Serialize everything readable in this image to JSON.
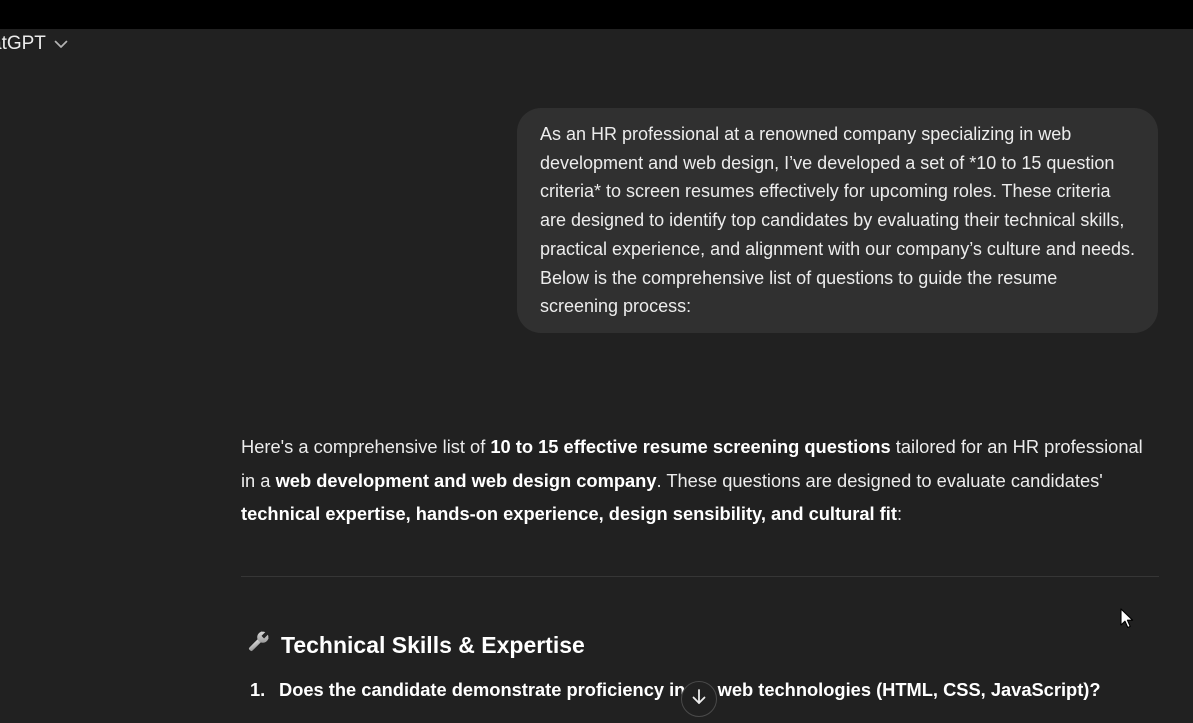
{
  "header": {
    "model_name": "atGPT",
    "chevron_icon": "chevron-down-icon"
  },
  "conversation": {
    "user_message": "As an HR professional at a renowned company specializing in web development and web design, I’ve developed a set of *10 to 15 question criteria* to screen resumes effectively for upcoming roles. These criteria are designed to identify top candidates by evaluating their technical skills, practical experience, and alignment with our company’s culture and needs. Below is the comprehensive list of questions to guide the resume screening process:",
    "assistant": {
      "intro_parts": [
        "Here's a comprehensive list of ",
        "10 to 15 effective resume screening questions",
        " tailored for an HR professional in a ",
        "web development and web design company",
        ". These questions are designed to evaluate candidates' ",
        "technical expertise, hands-on experience, design sensibility, and cultural fit",
        ":"
      ],
      "section_icon": "wrench-icon",
      "section_title": "Technical Skills & Expertise",
      "questions": [
        {
          "number": "1.",
          "text_before": "Does the candidate demonstrate proficiency in",
          "text_after": "e web technologies (HTML, CSS, JavaScript)?"
        }
      ]
    }
  },
  "controls": {
    "scroll_down_icon": "arrow-down-icon",
    "cursor_icon": "mouse-pointer-icon"
  },
  "colors": {
    "background": "#212121",
    "top_bar": "#000000",
    "user_bubble": "#303030",
    "text": "#ececec",
    "divider": "#363636"
  }
}
